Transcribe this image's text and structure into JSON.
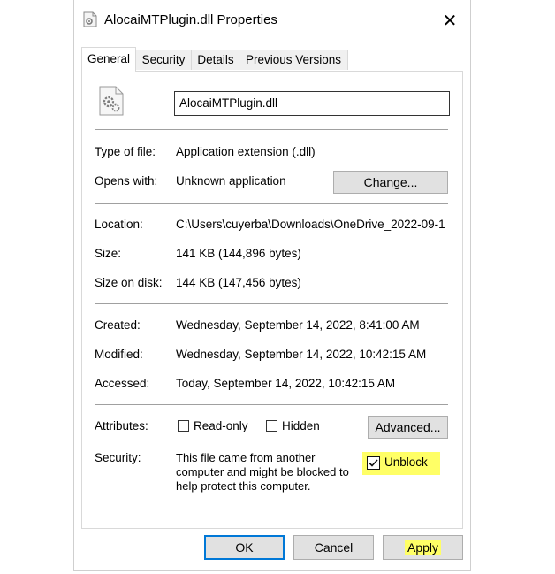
{
  "window": {
    "title": "AlocaiMTPlugin.dll Properties",
    "close_glyph": "✕"
  },
  "tabs": [
    {
      "label": "General",
      "active": true
    },
    {
      "label": "Security",
      "active": false
    },
    {
      "label": "Details",
      "active": false
    },
    {
      "label": "Previous Versions",
      "active": false
    }
  ],
  "file": {
    "name": "AlocaiMTPlugin.dll"
  },
  "info": {
    "type_label": "Type of file:",
    "type_value": "Application extension (.dll)",
    "opens_label": "Opens with:",
    "opens_value": "Unknown application",
    "change_button": "Change...",
    "location_label": "Location:",
    "location_value": "C:\\Users\\cuyerba\\Downloads\\OneDrive_2022-09-1",
    "size_label": "Size:",
    "size_value": "141 KB (144,896 bytes)",
    "size_on_disk_label": "Size on disk:",
    "size_on_disk_value": "144 KB (147,456 bytes)",
    "created_label": "Created:",
    "created_value": "Wednesday, September 14, 2022, 8:41:00 AM",
    "modified_label": "Modified:",
    "modified_value": "Wednesday, September 14, 2022, 10:42:15 AM",
    "accessed_label": "Accessed:",
    "accessed_value": "Today, September 14, 2022, 10:42:15 AM"
  },
  "attributes": {
    "label": "Attributes:",
    "readonly_label": "Read-only",
    "readonly_checked": false,
    "hidden_label": "Hidden",
    "hidden_checked": false,
    "advanced_button": "Advanced..."
  },
  "security": {
    "label": "Security:",
    "line1": "This file came from another",
    "line2": "computer and might be blocked to",
    "line3": "help protect this computer.",
    "unblock_label": "Unblock",
    "unblock_checked": true,
    "highlight_color": "#ffff66"
  },
  "footer": {
    "ok": "OK",
    "cancel": "Cancel",
    "apply": "Apply"
  },
  "colors": {
    "accent": "#0078d7",
    "button_face": "#e1e1e1"
  }
}
